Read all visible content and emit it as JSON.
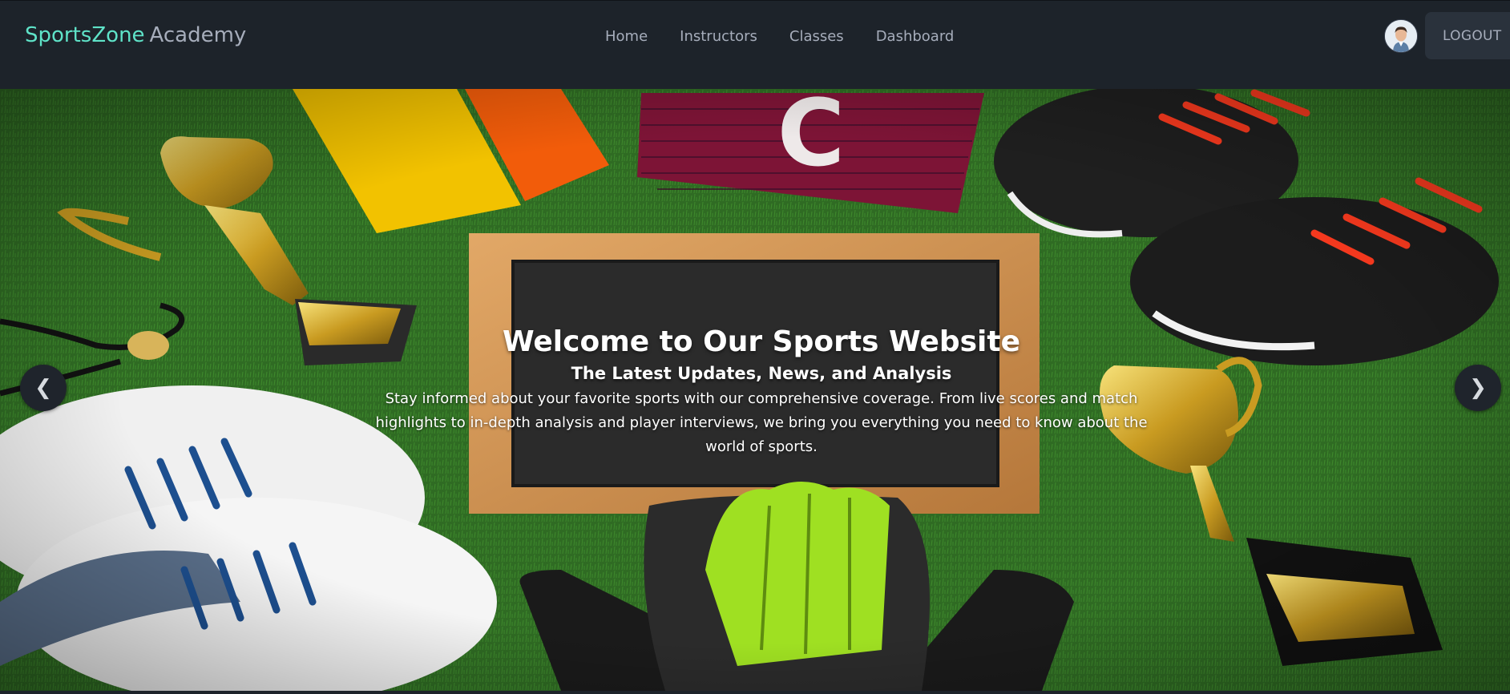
{
  "brand": {
    "primary": "SportsZone",
    "secondary": "Academy"
  },
  "nav": {
    "items": [
      "Home",
      "Instructors",
      "Classes",
      "Dashboard"
    ]
  },
  "user": {
    "logout_label": "LOGOUT"
  },
  "hero": {
    "title": "Welcome to Our Sports Website",
    "subtitle": "The Latest Updates, News, and Analysis",
    "text": "Stay informed about your favorite sports with our comprehensive coverage. From live scores and match highlights to in-depth analysis and player interviews, we bring you everything you need to know about the world of sports.",
    "captain_letter": "C"
  },
  "carousel": {
    "prev": "❮",
    "next": "❯"
  },
  "colors": {
    "brand_accent": "#5fe3c8",
    "navbar_bg": "#1d232a",
    "turf": "#2f6b23"
  }
}
